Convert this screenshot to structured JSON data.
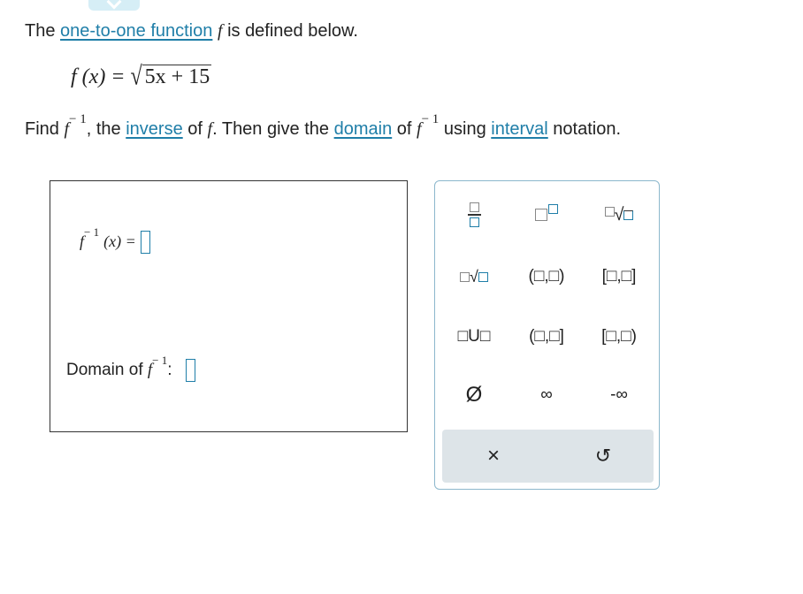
{
  "problem": {
    "intro_before": "The",
    "link_one_to_one": "one-to-one function",
    "intro_after": "is defined below.",
    "definition": {
      "lhs": "f (x) =",
      "radicand": "5x + 15"
    },
    "find": "Find",
    "the": ", the",
    "link_inverse": "inverse",
    "of_f_then": "of",
    "then_give": ". Then give the",
    "link_domain": "domain",
    "of2": "of",
    "using": "using",
    "link_interval": "interval",
    "notation": "notation."
  },
  "answer": {
    "inverse_lhs": "(x) =",
    "domain_label": "Domain of",
    "colon": ":"
  },
  "symbols": {
    "f": "f",
    "minus_one": "− 1"
  },
  "palette": {
    "row1": [
      "fraction",
      "superscript",
      "nth-root"
    ],
    "row2": [
      "mixed-radical",
      "(□,□)",
      "[□,□]"
    ],
    "row3": [
      "□U□",
      "(□,□]",
      "[□,□)"
    ],
    "row4": [
      "Ø",
      "∞",
      "-∞"
    ],
    "footer": [
      "×",
      "↺"
    ]
  },
  "colors": {
    "accent": "#1f7ea8",
    "palette_border": "#8cb7cc",
    "footer_bg": "#dde4e8"
  }
}
